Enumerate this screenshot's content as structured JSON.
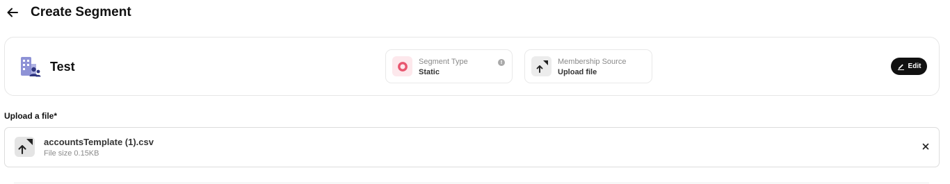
{
  "header": {
    "back_icon": "arrow-left-icon",
    "title": "Create Segment"
  },
  "segment": {
    "icon": "building-users-icon",
    "name": "Test",
    "type_card": {
      "icon": "ring-icon",
      "label": "Segment Type",
      "value": "Static",
      "info_icon": "info-icon"
    },
    "source_card": {
      "icon": "upload-file-icon",
      "label": "Membership Source",
      "value": "Upload file"
    },
    "edit_button": {
      "icon": "pencil-icon",
      "label": "Edit"
    }
  },
  "upload": {
    "label": "Upload a file*",
    "file": {
      "icon": "upload-file-icon",
      "name": "accountsTemplate (1).csv",
      "size": "File size 0.15KB",
      "remove_icon": "close-icon"
    }
  },
  "colors": {
    "accent_purple": "#6b6fc4",
    "ring_pink": "#e8566f",
    "edit_button_bg": "#111111",
    "border": "#e6e6e6"
  }
}
